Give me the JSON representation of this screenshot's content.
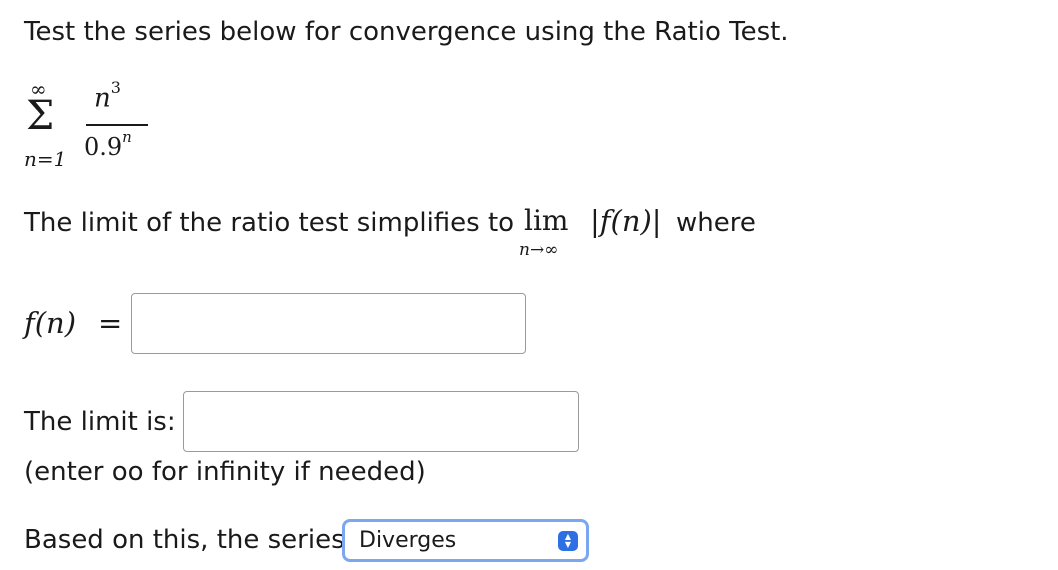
{
  "header": {
    "instruction": "Test the series below for convergence using the Ratio Test."
  },
  "series": {
    "sigma": "Σ",
    "upper_limit": "∞",
    "lower_limit": "n=1",
    "numerator_base": "n",
    "numerator_exp": "3",
    "denominator_base": "0.9",
    "denominator_exp": "n"
  },
  "limit_statement": {
    "text_before": "The limit of the ratio test simplifies to",
    "lim": "lim",
    "lim_sub": "n→∞",
    "expression": "|f(n)|",
    "text_after": "where"
  },
  "fn_field": {
    "label": "f(n)",
    "equals": "=",
    "value": ""
  },
  "limit_field": {
    "label": "The limit is:",
    "value": "",
    "hint": "(enter oo for infinity if needed)"
  },
  "conclusion": {
    "label": "Based on this, the series",
    "selected": "Diverges",
    "arrows": "▲▼"
  }
}
